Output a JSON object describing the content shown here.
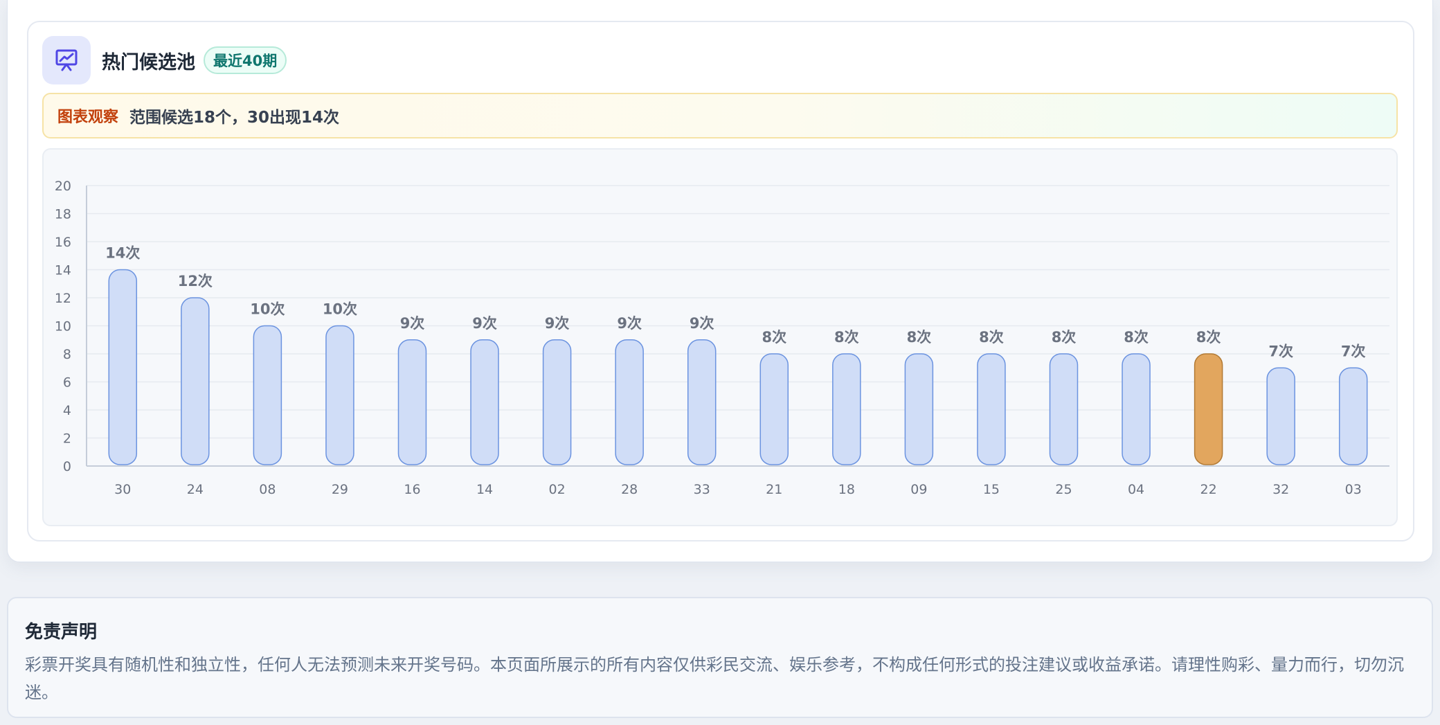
{
  "header": {
    "title": "热门候选池",
    "badge": "最近40期",
    "icon": "chart-presentation-icon"
  },
  "observation": {
    "tag": "图表观察",
    "text": "范围候选18个，30出现14次"
  },
  "chart_data": {
    "type": "bar",
    "categories": [
      "30",
      "24",
      "08",
      "29",
      "16",
      "14",
      "02",
      "28",
      "33",
      "21",
      "18",
      "09",
      "15",
      "25",
      "04",
      "22",
      "32",
      "03"
    ],
    "values": [
      14,
      12,
      10,
      10,
      9,
      9,
      9,
      9,
      9,
      8,
      8,
      8,
      8,
      8,
      8,
      8,
      7,
      7
    ],
    "value_labels": [
      "14次",
      "12次",
      "10次",
      "10次",
      "9次",
      "9次",
      "9次",
      "9次",
      "9次",
      "8次",
      "8次",
      "8次",
      "8次",
      "8次",
      "8次",
      "8次",
      "7次",
      "7次"
    ],
    "highlight_category": "22",
    "ylim": [
      0,
      20
    ],
    "yticks": [
      0,
      2,
      4,
      6,
      8,
      10,
      12,
      14,
      16,
      18,
      20
    ],
    "grid": true,
    "colors": {
      "bar_fill": "#d0ddf7",
      "bar_stroke": "#6b93e0",
      "highlight_fill": "#e2a65e",
      "highlight_stroke": "#b27a34",
      "label": "#6b7280",
      "axis": "#c5cdd9",
      "grid": "#e6eaf0"
    }
  },
  "disclaimer": {
    "title": "免责声明",
    "text": "彩票开奖具有随机性和独立性，任何人无法预测未来开奖号码。本页面所展示的所有内容仅供彩民交流、娱乐参考，不构成任何形式的投注建议或收益承诺。请理性购彩、量力而行，切勿沉迷。"
  }
}
